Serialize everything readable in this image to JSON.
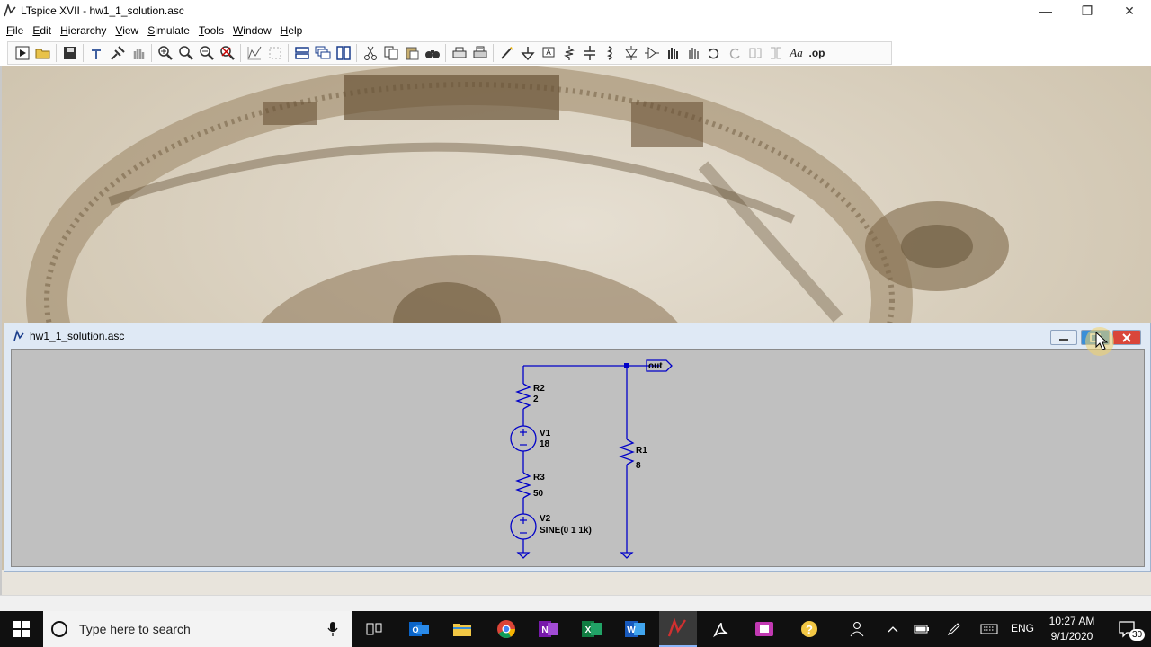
{
  "window": {
    "title": "LTspice XVII - hw1_1_solution.asc",
    "minimize": "—",
    "restore": "❐",
    "close": "✕"
  },
  "menu": {
    "items": [
      {
        "label": "File",
        "key": "F"
      },
      {
        "label": "Edit",
        "key": "E"
      },
      {
        "label": "Hierarchy",
        "key": "H"
      },
      {
        "label": "View",
        "key": "V"
      },
      {
        "label": "Simulate",
        "key": "S"
      },
      {
        "label": "Tools",
        "key": "T"
      },
      {
        "label": "Window",
        "key": "W"
      },
      {
        "label": "Help",
        "key": "H"
      }
    ]
  },
  "toolbar": {
    "buttons": [
      "run-icon",
      "open-icon",
      "save-icon",
      "hammer-icon",
      "probe-icon",
      "pan-hand-icon",
      "zoom-in-icon",
      "zoom-fit-icon",
      "zoom-out-icon",
      "cancel-zoom-icon",
      "autorange-icon",
      "grid-icon",
      "tile-horizontal-icon",
      "cascade-icon",
      "tile-vertical-icon",
      "cut-icon",
      "copy-icon",
      "paste-icon",
      "find-icon",
      "print-icon",
      "print-setup-icon",
      "wire-icon",
      "ground-icon",
      "label-net-icon",
      "resistor-icon",
      "capacitor-icon",
      "inductor-icon",
      "diode-icon",
      "component-icon",
      "move-icon",
      "drag-icon",
      "undo-icon",
      "redo-icon",
      "rotate-icon",
      "mirror-icon",
      "text-icon",
      "spice-directive-icon"
    ],
    "text_label": "Aa",
    "op_label": ".op"
  },
  "child": {
    "title": "hw1_1_solution.asc",
    "colors": {
      "wire": "#0000c8",
      "canvas": "#c0c0c0"
    }
  },
  "schematic": {
    "net_label": "out",
    "components": [
      {
        "ref": "R2",
        "value": "2"
      },
      {
        "ref": "V1",
        "value": "18"
      },
      {
        "ref": "R3",
        "value": "50"
      },
      {
        "ref": "V2",
        "value": "SINE(0 1 1k)"
      },
      {
        "ref": "R1",
        "value": "8"
      }
    ]
  },
  "taskbar": {
    "search_placeholder": "Type here to search",
    "lang": "ENG",
    "time": "10:27 AM",
    "date": "9/1/2020",
    "notifications": "30"
  }
}
